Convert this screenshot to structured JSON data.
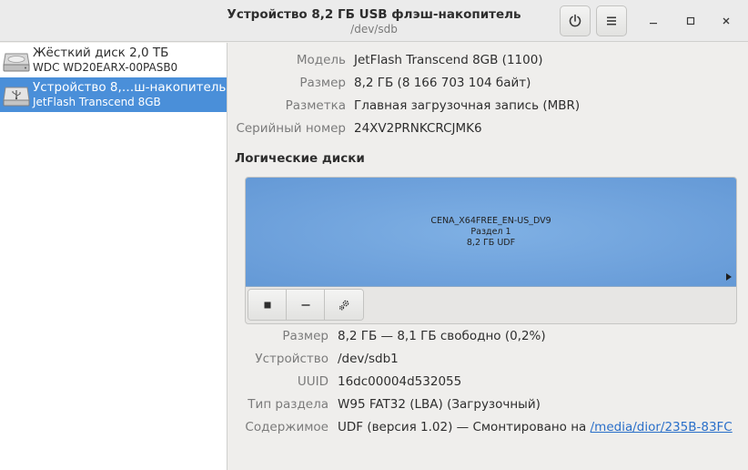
{
  "header": {
    "title": "Устройство 8,2 ГБ USB флэш-накопитель",
    "subtitle": "/dev/sdb"
  },
  "sidebar": {
    "drives": [
      {
        "name": "Жёсткий диск 2,0 ТБ",
        "model": "WDC WD20EARX-00PASB0",
        "icon": "hard-disk-icon",
        "selected": false
      },
      {
        "name": "Устройство 8,…ш-накопитель",
        "model": "JetFlash Transcend 8GB",
        "icon": "usb-drive-icon",
        "selected": true
      }
    ]
  },
  "drive_info": {
    "model_label": "Модель",
    "model_value": "JetFlash Transcend 8GB (1100)",
    "size_label": "Размер",
    "size_value": "8,2 ГБ (8 166 703 104 байт)",
    "partitioning_label": "Разметка",
    "partitioning_value": "Главная загрузочная запись (MBR)",
    "serial_label": "Серийный номер",
    "serial_value": "24XV2PRNKCRCJMK6"
  },
  "volumes": {
    "title": "Логические диски",
    "partition": {
      "label": "CENA_X64FREE_EN-US_DV9",
      "number": "Раздел 1",
      "size_fs": "8,2 ГБ UDF"
    },
    "toolbar": {
      "stop_icon": "stop-icon",
      "minus_icon": "minus-icon",
      "settings_icon": "gears-icon"
    }
  },
  "volume_info": {
    "size_label": "Размер",
    "size_value": "8,2 ГБ — 8,1 ГБ свободно (0,2%)",
    "device_label": "Устройство",
    "device_value": "/dev/sdb1",
    "uuid_label": "UUID",
    "uuid_value": "16dc00004d532055",
    "type_label": "Тип раздела",
    "type_value": "W95 FAT32 (LBA) (Загрузочный)",
    "contents_label": "Содержимое",
    "contents_value": "UDF (версия 1.02) — Смонтировано на",
    "mount_link": "/media/dior/235B-83FC"
  },
  "colors": {
    "selection": "#4a8fd9",
    "partition": "#6fa2dc",
    "link": "#2a6fc9"
  }
}
